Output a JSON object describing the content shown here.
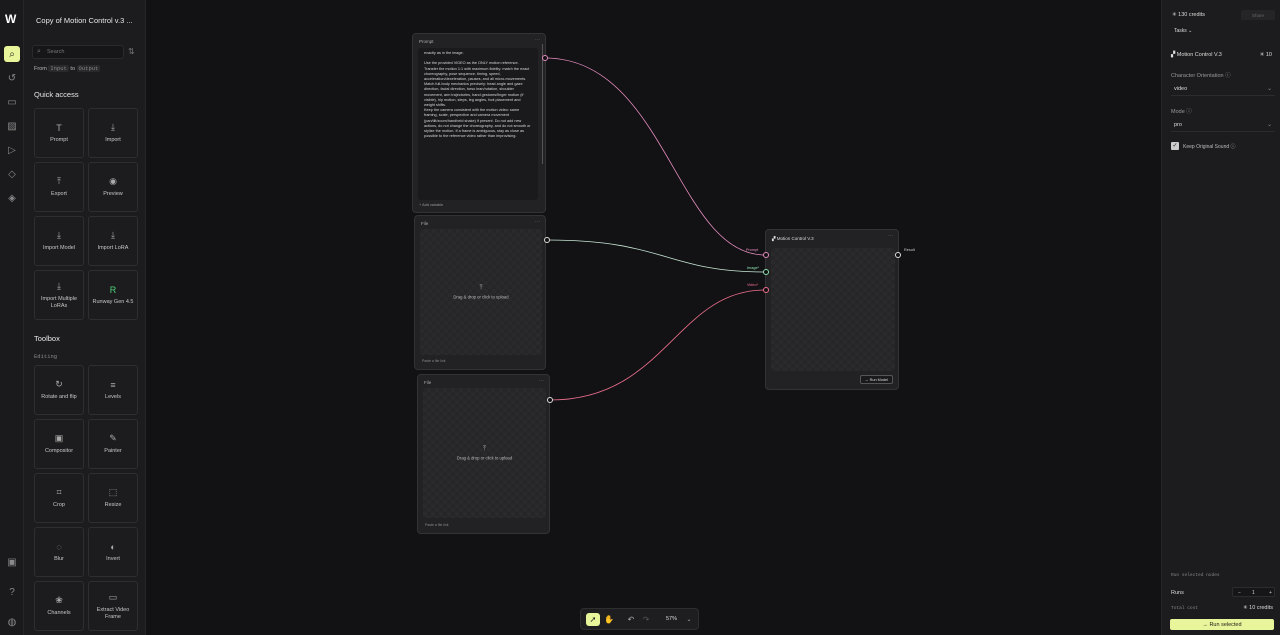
{
  "app": {
    "title": "Copy of Motion Control v.3 ...",
    "logo": "W"
  },
  "sidebar": {
    "search_placeholder": "Search",
    "from_label": "From",
    "from_tag": "Input",
    "to_label": "to",
    "to_tag": "Output",
    "quick_access_title": "Quick access",
    "quick_access": [
      {
        "label": "Prompt",
        "icon": "T"
      },
      {
        "label": "Import",
        "icon": "⤓"
      },
      {
        "label": "Export",
        "icon": "⤒"
      },
      {
        "label": "Preview",
        "icon": "◉"
      },
      {
        "label": "Import Model",
        "icon": "⤓"
      },
      {
        "label": "Import LoRA",
        "icon": "⤓"
      },
      {
        "label": "Import Multiple LoRAs",
        "icon": "⤓"
      },
      {
        "label": "Runway Gen 4.5",
        "icon": "R"
      }
    ],
    "toolbox_title": "Toolbox",
    "editing_label": "Editing",
    "toolbox": [
      {
        "label": "Rotate and flip",
        "icon": "↻"
      },
      {
        "label": "Levels",
        "icon": "≡"
      },
      {
        "label": "Compositor",
        "icon": "▣"
      },
      {
        "label": "Painter",
        "icon": "✎"
      },
      {
        "label": "Crop",
        "icon": "⌗"
      },
      {
        "label": "Resize",
        "icon": "⬚"
      },
      {
        "label": "Blur",
        "icon": "◌"
      },
      {
        "label": "Invert",
        "icon": "◐"
      },
      {
        "label": "Channels",
        "icon": "❀"
      },
      {
        "label": "Extract Video Frame",
        "icon": "▭"
      }
    ]
  },
  "canvas": {
    "prompt_node": {
      "header": "Prompt",
      "text": "exactly as in the image.\n\nUse the provided VIDEO as the ONLY motion reference. Transfer the motion 1:1 with maximum fidelity: match the exact choreography, pose sequence, timing, speed, acceleration/deceleration, pauses, and all micro-movements.\nMatch full-body mechanics precisely: head angle and gaze direction, facial direction, torso lean/rotation, shoulder movement, arm trajectories, hand gestures/finger motion (if visible), hip motion, steps, leg angles, foot placement and weight shifts.\nKeep the camera consistent with the motion video: same framing, scale, perspective and camera movement (pan/tilt/zoom/handheld shake) if present. Do not add new actions, do not change the choreography, and do not smooth or stylize the motion. If a frame is ambiguous, stay as close as possible to the reference video rather than improvising.",
      "add_variable": "+ Add variable"
    },
    "file_node_1": {
      "header": "File",
      "drop_text": "Drag & drop or click to upload",
      "footer": "Paste a file link"
    },
    "file_node_2": {
      "header": "File",
      "drop_text": "Drag & drop or click to upload",
      "footer": "Paste a file link"
    },
    "motion_node": {
      "header": "Motion Control V.3",
      "port_prompt": "Prompt",
      "port_image": "Image*",
      "port_video": "Video*",
      "port_result": "Result",
      "run_button": "→ Run Model"
    },
    "menu_glyph": "···"
  },
  "toolbar": {
    "zoom": "57%"
  },
  "right_panel": {
    "credits": "130 credits",
    "share": "Share",
    "tasks": "Tasks",
    "model_name": "Motion Control V.3",
    "model_cost": "10",
    "orientation_label": "Character Orientation",
    "orientation_value": "video",
    "mode_label": "Mode",
    "mode_value": "pro",
    "keep_sound_label": "Keep Original Sound",
    "keep_sound_checked": true,
    "run_selected_header": "Run selected nodes",
    "runs_label": "Runs",
    "runs_value": "1",
    "total_cost_label": "Total cost",
    "total_cost_value": "10 credits",
    "run_selected_button": "→ Run selected"
  },
  "colors": {
    "accent": "#e9f59a",
    "wire_pink": "#e48bbf",
    "wire_green": "#8ee0b0",
    "wire_red": "#f07090"
  }
}
